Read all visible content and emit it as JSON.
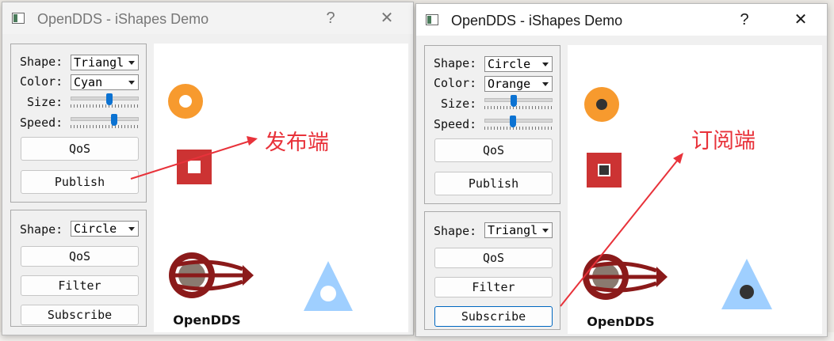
{
  "windows": [
    {
      "title": "OpenDDS - iShapes Demo",
      "help": "?",
      "close": "✕",
      "publisher": {
        "shape_label": "Shape:",
        "shape_value": "Triangl",
        "color_label": "Color:",
        "color_value": "Cyan",
        "size_label": "Size:",
        "size_level": 0.58,
        "speed_label": "Speed:",
        "speed_level": 0.66,
        "qos": "QoS",
        "publish": "Publish"
      },
      "subscriber": {
        "shape_label": "Shape:",
        "shape_value": "Circle",
        "qos": "QoS",
        "filter": "Filter",
        "subscribe": "Subscribe"
      },
      "logo_text": "OpenDDS"
    },
    {
      "title": "OpenDDS - iShapes Demo",
      "help": "?",
      "close": "✕",
      "publisher": {
        "shape_label": "Shape:",
        "shape_value": "Circle",
        "color_label": "Color:",
        "color_value": "Orange",
        "size_label": "Size:",
        "size_level": 0.42,
        "speed_label": "Speed:",
        "speed_level": 0.41,
        "qos": "QoS",
        "publish": "Publish"
      },
      "subscriber": {
        "shape_label": "Shape:",
        "shape_value": "Triangl",
        "qos": "QoS",
        "filter": "Filter",
        "subscribe": "Subscribe"
      },
      "logo_text": "OpenDDS"
    }
  ],
  "annotations": {
    "publisher": "发布端",
    "subscriber": "订阅端"
  },
  "colors": {
    "orange": "#f79a2e",
    "red": "#cc3333",
    "light_blue": "#9fcfff",
    "annotation": "#e8323a",
    "logo_red": "#8b1a1a"
  }
}
